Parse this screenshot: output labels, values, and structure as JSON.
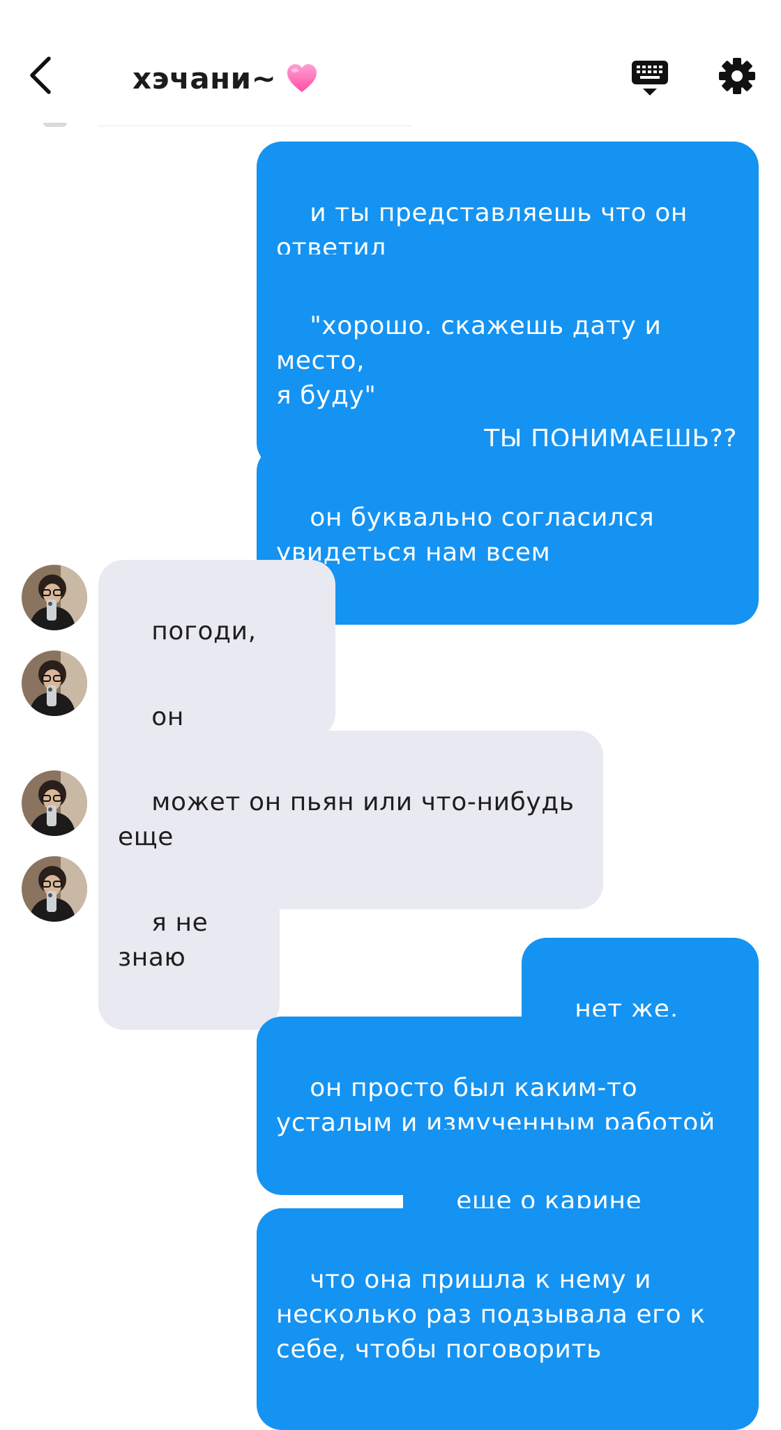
{
  "header": {
    "title": "хэчани~",
    "title_emoji": "pink-heart"
  },
  "colors": {
    "outgoing_bubble": "#1593f2",
    "incoming_bubble": "#e9eaf1",
    "heart": "#ff6fb4"
  },
  "icons": {
    "back": "chevron-left-icon",
    "keyboard": "keyboard-icon",
    "settings": "gear-icon"
  },
  "messages": [
    {
      "side": "out",
      "text": "и ты представляешь что он\nответил"
    },
    {
      "side": "out",
      "text": "\"хорошо. скажешь дату и место,\nя буду\""
    },
    {
      "side": "out",
      "text": "ТЫ ПОНИМАЕШЬ??"
    },
    {
      "side": "out",
      "text": "он буквально согласился\nувидеться нам всем"
    },
    {
      "side": "in",
      "text": "погоди, что??"
    },
    {
      "side": "in",
      "text": "он реально?"
    },
    {
      "side": "in",
      "text": "может он пьян или что-нибудь\nеще"
    },
    {
      "side": "in",
      "text": "я не знаю"
    },
    {
      "side": "out",
      "text": "нет же, дурак"
    },
    {
      "side": "out",
      "text": "он просто был каким-то\nусталым и измученным работой"
    },
    {
      "side": "out",
      "text": "еще о карине говорил"
    },
    {
      "side": "out",
      "text": "что она пришла к нему и\nнесколько раз подзывала его к\nсебе, чтобы поговорить"
    }
  ]
}
